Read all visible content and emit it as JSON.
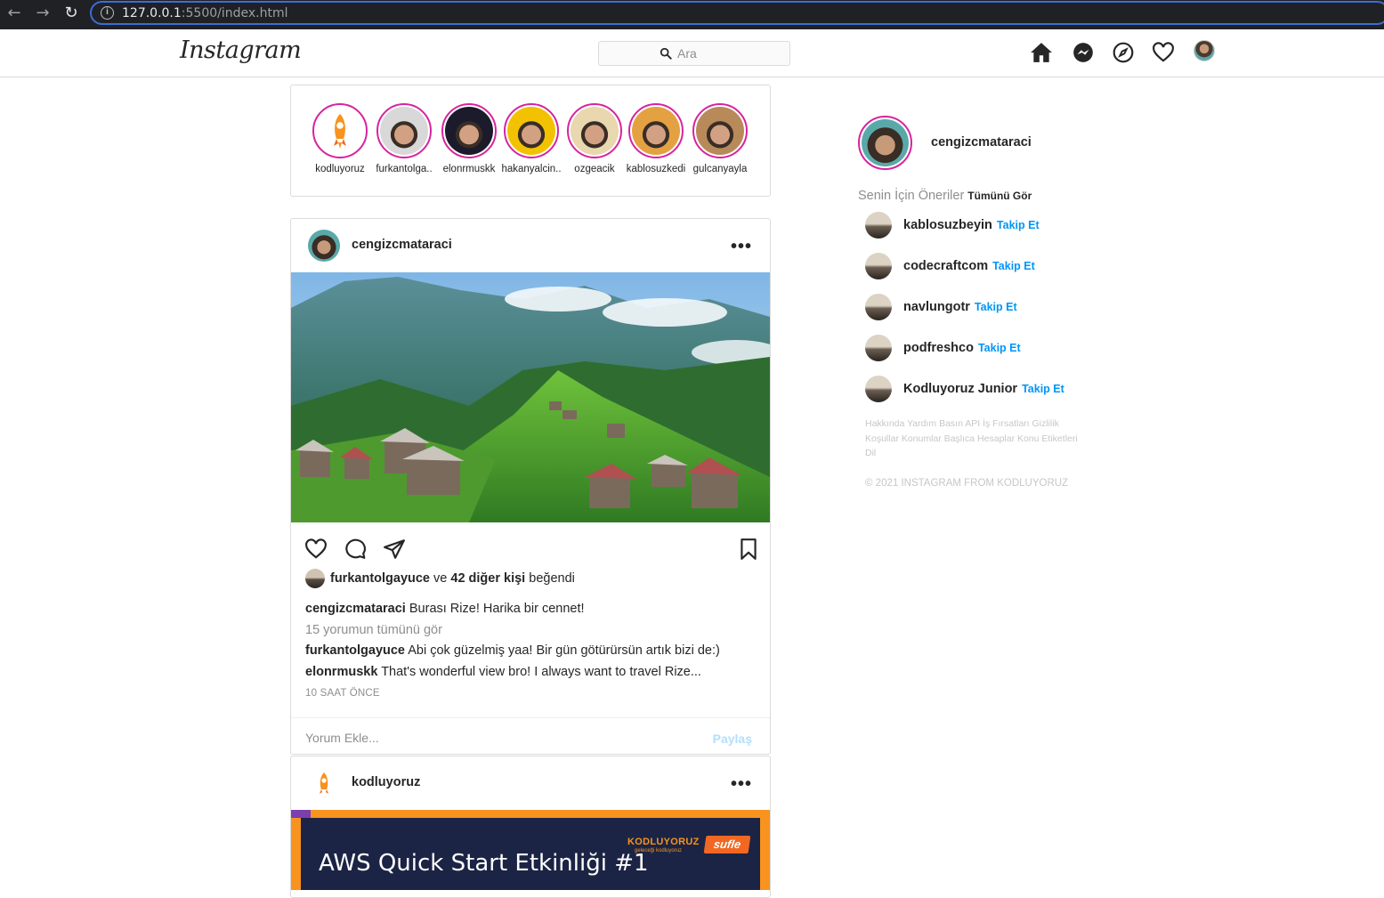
{
  "browser": {
    "url_host": "127.0.0.1",
    "url_rest": ":5500/index.html"
  },
  "header": {
    "logo": "Instagram",
    "search_placeholder": "Ara"
  },
  "stories": [
    {
      "name": "kodluyoruz",
      "color": "#ffffff",
      "kind": "rocket"
    },
    {
      "name": "furkantolga..",
      "color": "#d8d8d8",
      "kind": "face"
    },
    {
      "name": "elonrmuskk",
      "color": "#1b1b2b",
      "kind": "face"
    },
    {
      "name": "hakanyalcin..",
      "color": "#f2c200",
      "kind": "face"
    },
    {
      "name": "ozgeacik",
      "color": "#e9d7b0",
      "kind": "face"
    },
    {
      "name": "kablosuzkedi",
      "color": "#e4a142",
      "kind": "face"
    },
    {
      "name": "gulcanyayla",
      "color": "#b88a5a",
      "kind": "face"
    }
  ],
  "post1": {
    "user": "cengizcmataraci",
    "likes_user": "furkantolgayuce",
    "likes_and": "ve",
    "likes_others": "42 diğer kişi",
    "likes_suffix": "beğendi",
    "caption_user": "cengizcmataraci",
    "caption_text": "Burası Rize! Harika bir cennet!",
    "view_comments": "15 yorumun tümünü gör",
    "comments": [
      {
        "user": "furkantolgayuce",
        "text": "Abi çok güzelmiş yaa! Bir gün götürürsün artık bizi de:)"
      },
      {
        "user": "elonrmuskk",
        "text": "That's wonderful view bro! I always want to travel Rize..."
      }
    ],
    "time": "10 SAAT ÖNCE",
    "comment_placeholder": "Yorum Ekle...",
    "share_label": "Paylaş"
  },
  "post2": {
    "user": "kodluyoruz",
    "banner_title": "AWS Quick Start Etkinliği #1",
    "banner_brand": "KODLUYORUZ",
    "banner_sub": "geleceği kodluyoruz",
    "banner_partner": "sufle"
  },
  "sidebar": {
    "me": "cengizcmataraci",
    "suggestions_title": "Senin İçin Öneriler",
    "see_all": "Tümünü Gör",
    "follow_label": "Takip Et",
    "suggestions": [
      "kablosuzbeyin",
      "codecraftcom",
      "navlungotr",
      "podfreshco",
      "Kodluyoruz Junior"
    ],
    "footer_links": "Hakkında Yardım Basın API İş Fırsatları Gizlilik Koşullar Konumlar Başlıca Hesaplar Konu Etiketleri Dil",
    "copyright": "© 2021 INSTAGRAM FROM KODLUYORUZ"
  },
  "colors": {
    "link_blue": "#0095f6",
    "share_disabled": "#b2dffc",
    "story_ring": "#d6249f"
  }
}
